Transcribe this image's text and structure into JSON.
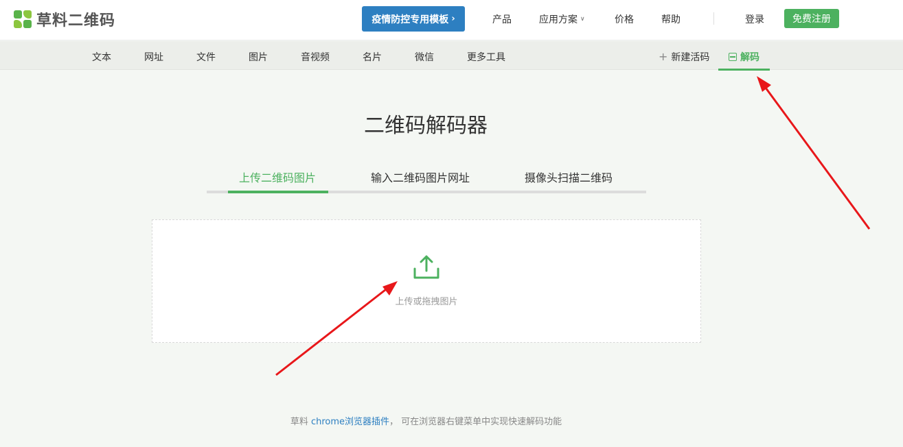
{
  "header": {
    "logo_text": "草料二维码",
    "promo_button": "疫情防控专用模板",
    "promo_chevron": "›",
    "nav": {
      "products": "产品",
      "solutions": "应用方案",
      "pricing": "价格",
      "help": "帮助"
    },
    "login": "登录",
    "register": "免费注册"
  },
  "subnav": {
    "items": [
      "文本",
      "网址",
      "文件",
      "图片",
      "音视频",
      "名片",
      "微信",
      "更多工具"
    ],
    "new_live_code": "新建活码",
    "decode": "解码"
  },
  "main": {
    "title": "二维码解码器",
    "tabs": [
      "上传二维码图片",
      "输入二维码图片网址",
      "摄像头扫描二维码"
    ],
    "active_tab": 0,
    "upload_label": "上传或拖拽图片"
  },
  "footer": {
    "prefix": "草料 ",
    "link_text": "chrome浏览器插件",
    "suffix": "， 可在浏览器右键菜单中实现快速解码功能"
  },
  "colors": {
    "brand_green": "#4cb15f",
    "promo_blue": "#2d7fc1",
    "annotation_red": "#e8171a"
  }
}
